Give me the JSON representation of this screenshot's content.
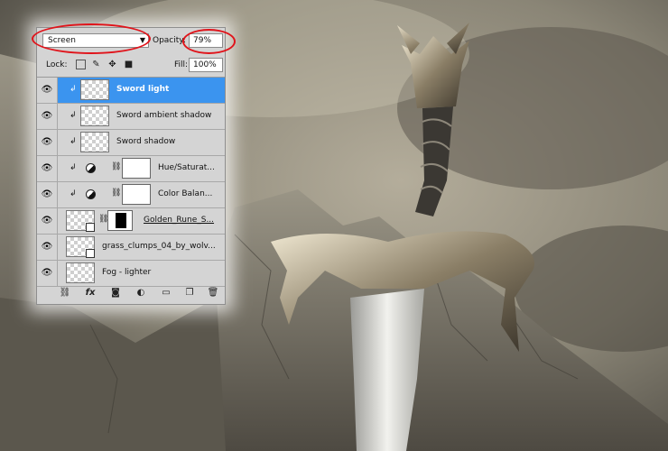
{
  "panel": {
    "blend_mode": "Screen",
    "opacity_label": "Opacity:",
    "opacity_value": "79%",
    "lock_label": "Lock:",
    "fill_label": "Fill:",
    "fill_value": "100%"
  },
  "layers": [
    {
      "name": "Sword light",
      "selected": true
    },
    {
      "name": "Sword ambient shadow"
    },
    {
      "name": "Sword shadow"
    },
    {
      "name": "Hue/Saturat..."
    },
    {
      "name": "Color Balan..."
    },
    {
      "name": "Golden_Rune_S..."
    },
    {
      "name": "grass_clumps_04_by_wolv..."
    },
    {
      "name": "Fog - lighter"
    }
  ],
  "icons": {
    "eye": "eye-icon",
    "link": "link-icon",
    "fx": "fx-icon",
    "mask": "add-mask-icon",
    "adjustment": "adjustment-layer-icon",
    "group": "folder-icon",
    "new_layer": "new-layer-icon",
    "trash": "trash-icon"
  },
  "colors": {
    "selection": "#3b94ef",
    "highlight_ring": "#e0141b"
  }
}
